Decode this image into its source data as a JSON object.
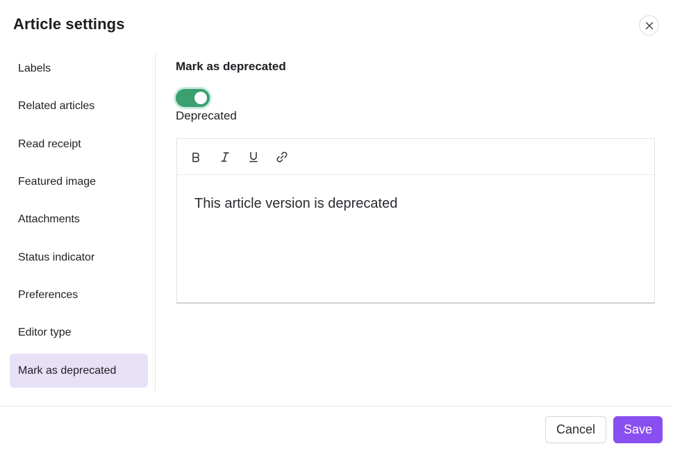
{
  "dialog": {
    "title": "Article settings"
  },
  "sidebar": {
    "items": [
      {
        "label": "Labels",
        "active": false
      },
      {
        "label": "Related articles",
        "active": false
      },
      {
        "label": "Read receipt",
        "active": false
      },
      {
        "label": "Featured image",
        "active": false
      },
      {
        "label": "Attachments",
        "active": false
      },
      {
        "label": "Status indicator",
        "active": false
      },
      {
        "label": "Preferences",
        "active": false
      },
      {
        "label": "Editor type",
        "active": false
      },
      {
        "label": "Mark as deprecated",
        "active": true
      }
    ]
  },
  "main": {
    "section_title": "Mark as deprecated",
    "toggle": {
      "on": true,
      "label": "Deprecated"
    },
    "editor": {
      "toolbar": [
        {
          "icon": "bold-icon"
        },
        {
          "icon": "italic-icon"
        },
        {
          "icon": "underline-icon"
        },
        {
          "icon": "link-icon"
        }
      ],
      "content": "This article version is deprecated"
    }
  },
  "footer": {
    "cancel_label": "Cancel",
    "save_label": "Save"
  },
  "colors": {
    "accent": "#8a4ff0",
    "toggle_on": "#3aa06f",
    "active_item_bg": "#e7e0f7"
  }
}
